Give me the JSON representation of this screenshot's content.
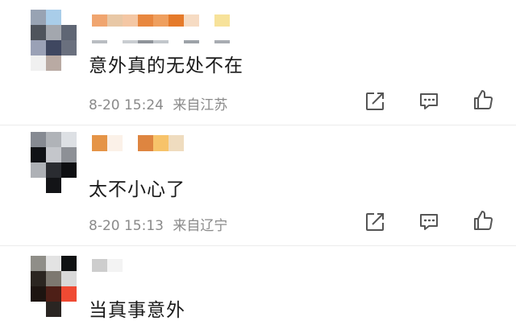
{
  "comments": [
    {
      "text": "意外真的无处不在",
      "time": "8-20 15:24",
      "location": "来自江苏",
      "avatar_colors": [
        "#98a3b3",
        "#a9cde9",
        "#ffffff",
        "#4f545c",
        "#a3a7ae",
        "#5f6674",
        "#9aa1b6",
        "#3f4760",
        "#6a707e",
        "#f0f0f0",
        "#b9aaa3",
        "#ffffff"
      ],
      "name_colors": [
        "#f0a56f",
        "#e8c8a6",
        "#f4c7a4",
        "#e8873f",
        "#ef9f5e",
        "#e57a2a",
        "#f6dbc3",
        "#ffffff",
        "#f7e29a"
      ],
      "sub_colors": [
        "#b9bdc2",
        "#ffffff",
        "#c9cdd1",
        "#8f949a",
        "#c2c6cb",
        "#ffffff",
        "#9da2a8",
        "#ffffff",
        "#a8acb2"
      ]
    },
    {
      "text": "太不小心了",
      "time": "8-20 15:13",
      "location": "来自辽宁",
      "avatar_colors": [
        "#868a92",
        "#b0b3b8",
        "#dde0e4",
        "#101216",
        "#c4c6cb",
        "#8d9096",
        "#aeb1b6",
        "#2a2c31",
        "#0d0e11",
        "#ffffff",
        "#131417",
        "#ffffff"
      ],
      "name_colors": [
        "#e59447",
        "#fbf1e8",
        "#ffffff",
        "#de8540",
        "#f7c36a",
        "#efdcbf"
      ],
      "sub_colors": []
    },
    {
      "text": "当真事意外",
      "time": "",
      "location": "",
      "avatar_colors": [
        "#8f8e88",
        "#e3e3e3",
        "#0f1112",
        "#2b2520",
        "#7d7870",
        "#d9d9d9",
        "#1d1410",
        "#4e1f17",
        "#ef4a33",
        "#ffffff",
        "#2a2522",
        "#ffffff"
      ],
      "name_colors": [
        "#cdcdcd",
        "#f3f3f3"
      ],
      "sub_colors": []
    }
  ],
  "icons": {
    "share": "share-icon",
    "comment": "comment-icon",
    "like": "like-icon"
  }
}
